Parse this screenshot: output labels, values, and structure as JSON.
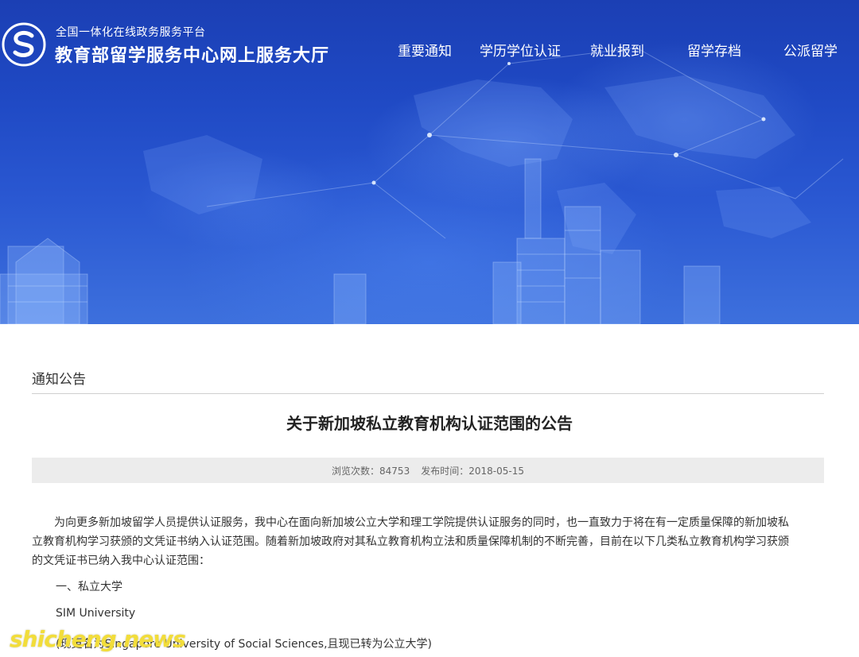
{
  "header": {
    "brand_sub": "全国一体化在线政务服务平台",
    "brand_main": "教育部留学服务中心网上服务大厅",
    "nav": [
      {
        "label": "重要通知"
      },
      {
        "label": "学历学位认证"
      },
      {
        "label": "就业报到"
      },
      {
        "label": "留学存档"
      },
      {
        "label": "公派留学"
      }
    ]
  },
  "section": {
    "title": "通知公告"
  },
  "article": {
    "title": "关于新加坡私立教育机构认证范围的公告",
    "views_label": "浏览次数：",
    "views": "84753",
    "date_label": "发布时间：",
    "date": "2018-05-15",
    "paragraph_lines": [
      "为向更多新加坡留学人员提供认证服务，我中心在面向新加坡公立大学和理工学院提供认证服务的同时，也一直致力于将在有一定质量保障的新加坡私",
      "立教育机构学习获颁的文凭证书纳入认证范围。随着新加坡政府对其私立教育机构立法和质量保障机制的不断完善，目前在以下几类私立教育机构学习获颁",
      "的文凭证书已纳入我中心认证范围："
    ],
    "heading_1": "一、私立大学",
    "school_1": "SIM University",
    "school_1_note": "(现更名为Singapore University of Social Sciences,且现已转为公立大学)"
  },
  "watermark": "shicheng.news",
  "colors": {
    "hero_top": "#1b3fb4",
    "hero_bottom": "#3d70dd",
    "meta_bg": "#ececec",
    "watermark": "#f2dd3a"
  }
}
